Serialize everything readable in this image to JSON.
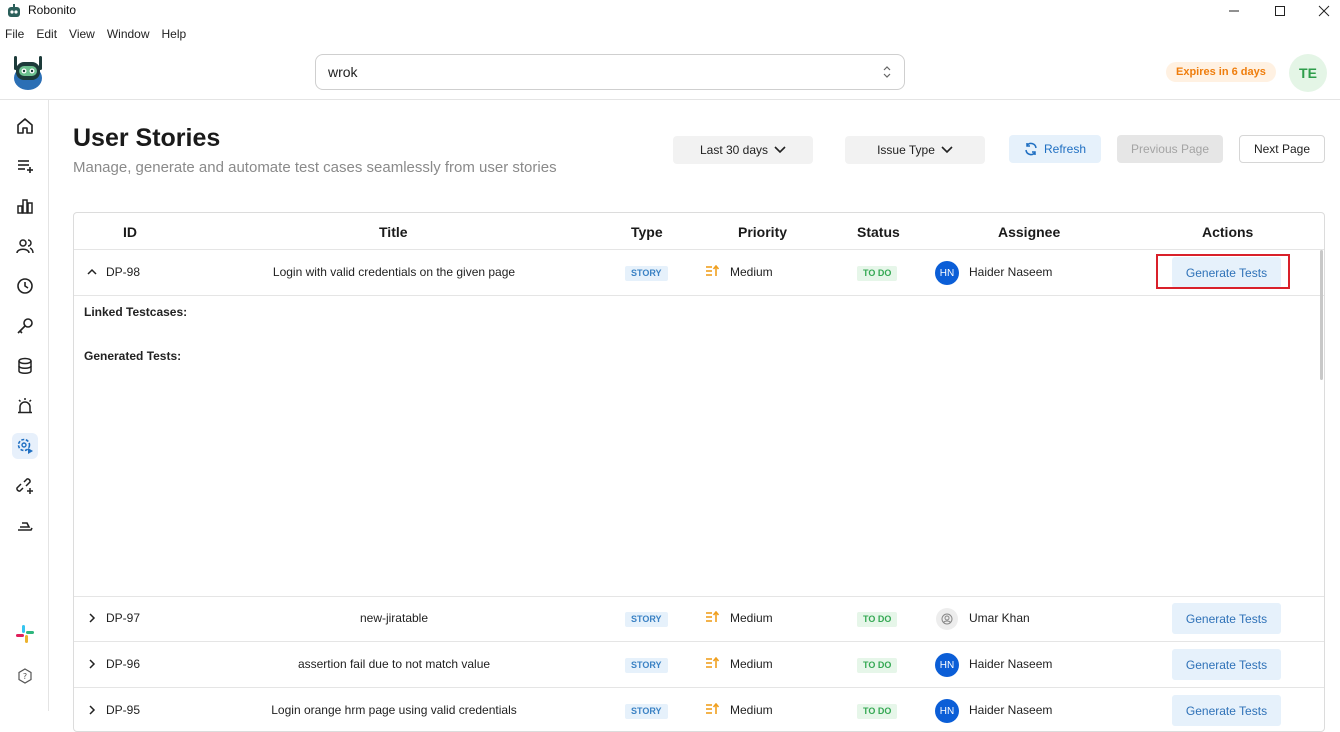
{
  "window": {
    "title": "Robonito"
  },
  "menu": [
    "File",
    "Edit",
    "View",
    "Window",
    "Help"
  ],
  "project": {
    "value": "wrok"
  },
  "license": {
    "expires": "Expires in 6 days"
  },
  "user": {
    "initials": "TE"
  },
  "sidebar": {
    "icons": [
      "home-icon",
      "add-list-icon",
      "bar-chart-icon",
      "users-icon",
      "clock-icon",
      "key-icon",
      "database-icon",
      "alarm-icon",
      "settings-play-icon",
      "link-add-icon",
      "runner-icon"
    ],
    "active": "settings-play-icon",
    "bottom": [
      "slack-icon",
      "help-icon"
    ]
  },
  "page": {
    "title": "User Stories",
    "subtitle": "Manage, generate and automate test cases seamlessly from user stories"
  },
  "toolbar": {
    "date_filter": "Last 30 days",
    "issue_type": "Issue Type",
    "refresh": "Refresh",
    "previous": "Previous Page",
    "next": "Next Page"
  },
  "table": {
    "headers": {
      "id": "ID",
      "title": "Title",
      "type": "Type",
      "priority": "Priority",
      "status": "Status",
      "assignee": "Assignee",
      "actions": "Actions"
    },
    "rows": [
      {
        "id": "DP-98",
        "title": "Login with valid credentials on the given page",
        "type": "STORY",
        "priority": "Medium",
        "status": "TO DO",
        "assignee": "Haider Naseem",
        "initials": "HN",
        "action": "Generate Tests",
        "expanded": true
      },
      {
        "id": "DP-97",
        "title": "new-jiratable",
        "type": "STORY",
        "priority": "Medium",
        "status": "TO DO",
        "assignee": "Umar Khan",
        "initials": "",
        "action": "Generate Tests",
        "expanded": false
      },
      {
        "id": "DP-96",
        "title": "assertion fail due to not match value",
        "type": "STORY",
        "priority": "Medium",
        "status": "TO DO",
        "assignee": "Haider Naseem",
        "initials": "HN",
        "action": "Generate Tests",
        "expanded": false
      },
      {
        "id": "DP-95",
        "title": "Login orange hrm page using valid credentials",
        "type": "STORY",
        "priority": "Medium",
        "status": "TO DO",
        "assignee": "Haider Naseem",
        "initials": "HN",
        "action": "Generate Tests",
        "expanded": false
      }
    ],
    "expanded": {
      "linked": "Linked Testcases:",
      "generated": "Generated Tests:"
    }
  },
  "colors": {
    "accent": "#1f6fc2",
    "highlight": "#d9202a",
    "status_green": "#34a853",
    "expires_orange": "#ef7d0c"
  }
}
